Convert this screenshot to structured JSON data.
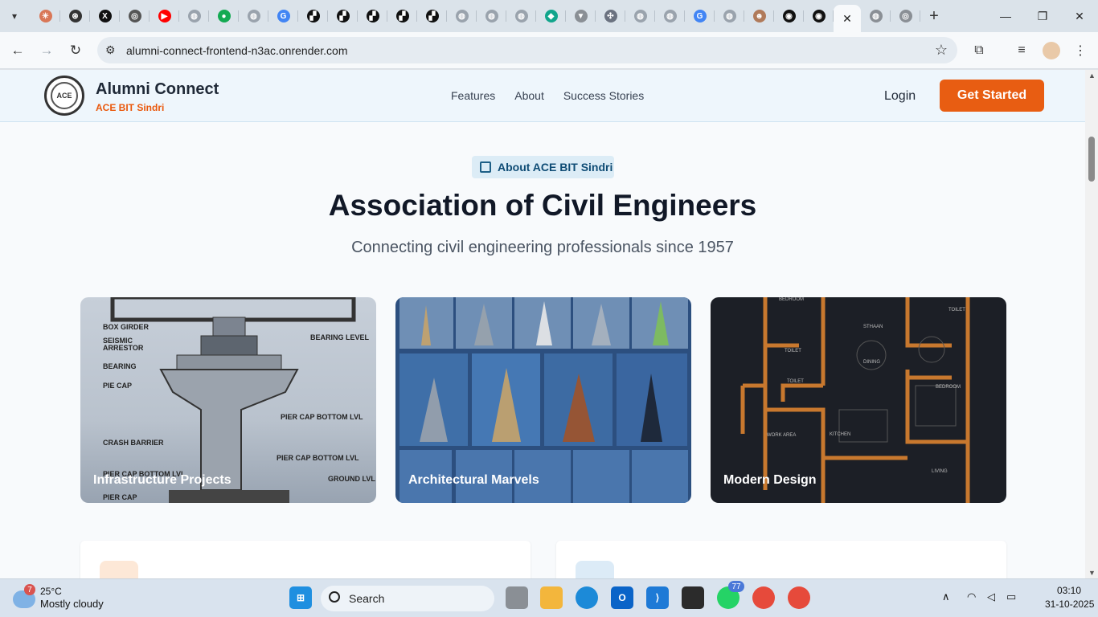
{
  "browser": {
    "tabs": [
      {
        "icon": "chevron-down-icon"
      },
      {
        "icon": "claude-icon",
        "color": "#d97757"
      },
      {
        "icon": "chatgpt-icon",
        "color": "#333333"
      },
      {
        "icon": "x-icon",
        "color": "#111111"
      },
      {
        "icon": "chrome-icon",
        "color": "#555555"
      },
      {
        "icon": "youtube-icon",
        "color": "#ff0000"
      },
      {
        "icon": "globe-icon",
        "color": "#9aa3ad"
      },
      {
        "icon": "mongodb-icon",
        "color": "#13aa52"
      },
      {
        "icon": "globe-icon",
        "color": "#9aa3ad"
      },
      {
        "icon": "google-icon",
        "color": "#4285f4"
      },
      {
        "icon": "render-icon",
        "color": "#111111"
      },
      {
        "icon": "render-icon",
        "color": "#111111"
      },
      {
        "icon": "render-icon",
        "color": "#111111"
      },
      {
        "icon": "render-icon",
        "color": "#111111"
      },
      {
        "icon": "render-icon",
        "color": "#111111"
      },
      {
        "icon": "globe-icon",
        "color": "#9aa3ad"
      },
      {
        "icon": "globe-icon",
        "color": "#9aa3ad"
      },
      {
        "icon": "globe-icon",
        "color": "#9aa3ad"
      },
      {
        "icon": "diamond-icon",
        "color": "#12a58c"
      },
      {
        "icon": "vercel-icon",
        "color": "#8a8f95"
      },
      {
        "icon": "network-icon",
        "color": "#6b7280"
      },
      {
        "icon": "globe-icon",
        "color": "#9aa3ad"
      },
      {
        "icon": "globe-icon",
        "color": "#9aa3ad"
      },
      {
        "icon": "google-icon",
        "color": "#4285f4"
      },
      {
        "icon": "globe-icon",
        "color": "#9aa3ad"
      },
      {
        "icon": "avatar-icon",
        "color": "#b07a5a"
      },
      {
        "icon": "github-icon",
        "color": "#111111"
      },
      {
        "icon": "github-icon",
        "color": "#111111"
      }
    ],
    "active_tab_close": "✕",
    "new_tab": "+",
    "url": "alumni-connect-frontend-n3ac.onrender.com"
  },
  "site": {
    "brand_title": "Alumni Connect",
    "brand_subtitle": "ACE BIT Sindri",
    "logo_text": "ACE",
    "nav": [
      "Features",
      "About",
      "Success Stories"
    ],
    "login": "Login",
    "cta": "Get Started",
    "accent": "#e85d12"
  },
  "hero": {
    "badge": "About ACE BIT Sindri",
    "title": "Association of Civil Engineers",
    "subtitle": "Connecting civil engineering professionals since 1957"
  },
  "cards": [
    {
      "label": "Infrastructure Projects"
    },
    {
      "label": "Architectural Marvels"
    },
    {
      "label": "Modern Design"
    }
  ],
  "diagram_labels": {
    "box_girder": "BOX GIRDER",
    "seismic": "SEISMIC",
    "arrestor": "ARRESTOR",
    "bearing": "BEARING",
    "bearing_level": "BEARING LEVEL",
    "pie_cap": "PIE CAP",
    "pier_cap_bottom_lvl": "PIER CAP BOTTOM LVL",
    "crash_barrier": "CRASH BARRIER",
    "pier_cap_bottom_lvl2": "PIER CAP BOTTOM LVL",
    "pier_cap_bottom_lvl3": "PIER CAP BOTTOM LVL",
    "ground_lvl": "GROUND LVL",
    "pier_cap": "PIER CAP"
  },
  "floorplan_labels": {
    "bedroom": "BEDROOM",
    "toilet1": "TOILET",
    "toilet2": "TOILET",
    "toilet3": "TOILET",
    "dining": "DINING",
    "bedroom2": "BEDROOM",
    "work_area": "WORK AREA",
    "kitchen": "KITCHEN",
    "living": "LIVING",
    "sthaan": "STHAAN"
  },
  "taskbar": {
    "weather_badge": "7",
    "temperature": "25°C",
    "condition": "Mostly cloudy",
    "search": "Search",
    "whatsapp_badge": "77",
    "time": "03:10",
    "date": "31-10-2025"
  }
}
